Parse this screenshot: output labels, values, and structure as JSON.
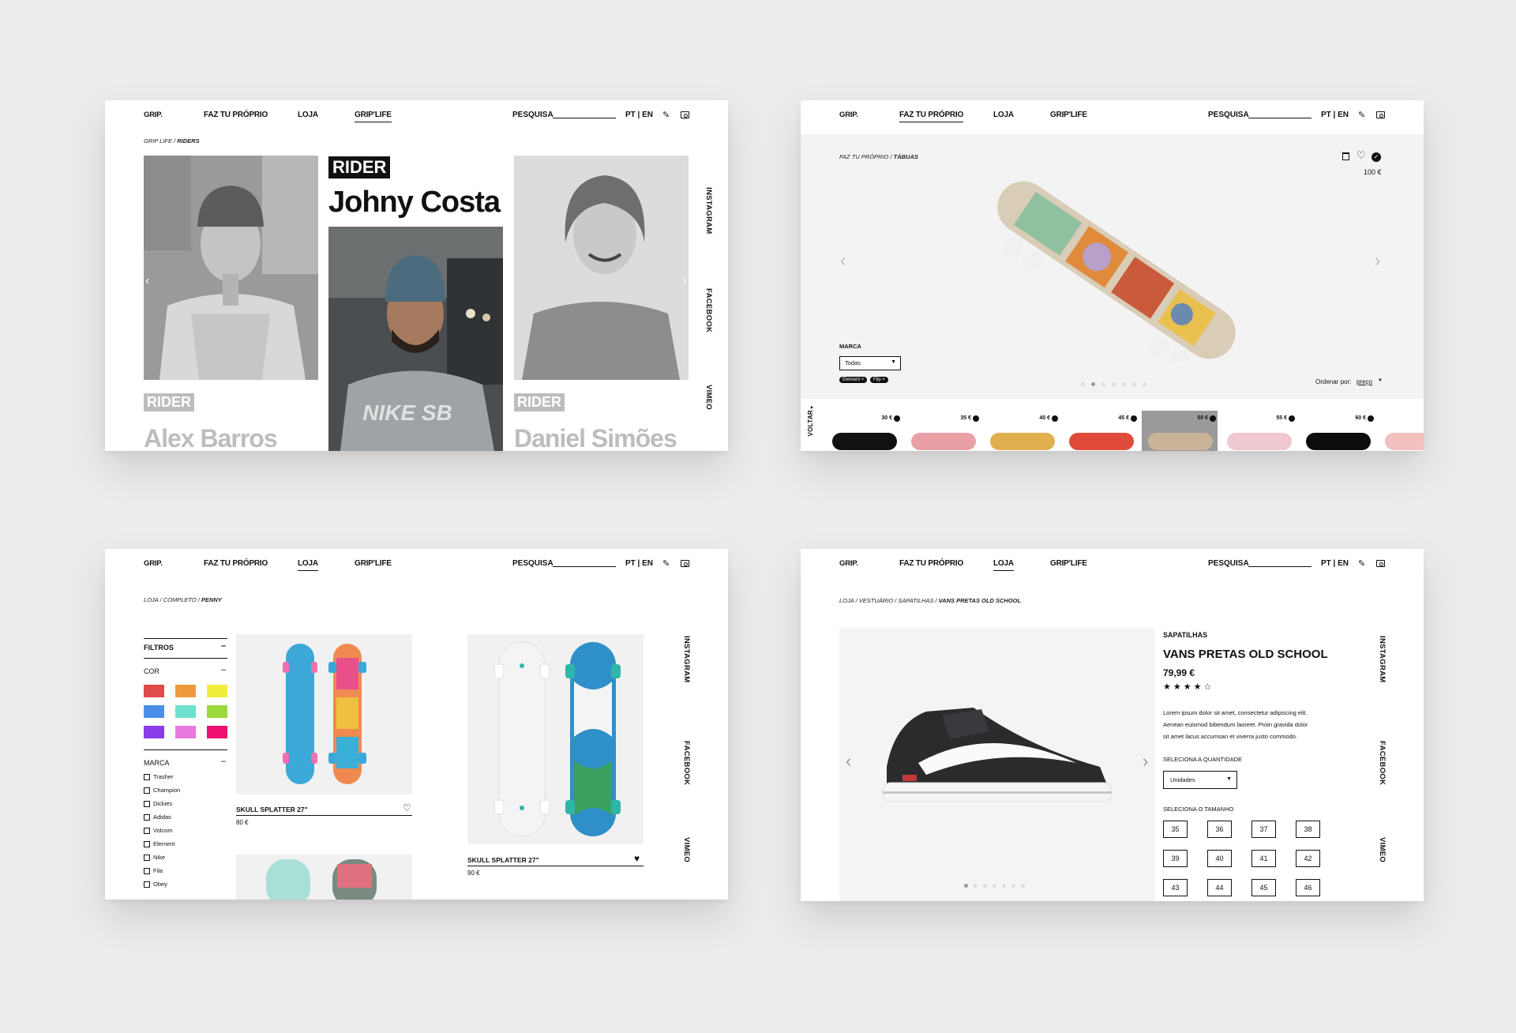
{
  "nav": {
    "logo": "GRIP.",
    "faz": "FAZ TU PRÓPRIO",
    "loja": "LOJA",
    "griplife": "GRIP'LIFE",
    "search": "PESQUISA",
    "lang": "PT | EN"
  },
  "social": {
    "instagram": "INSTAGRAM",
    "facebook": "FACEBOOK",
    "vimeo": "VIMEO"
  },
  "icons": [
    "pencil-icon",
    "cart-icon",
    "trash-icon",
    "heart-icon",
    "check-icon",
    "chevron-left-icon",
    "chevron-right-icon"
  ],
  "panel1": {
    "breadcrumb": {
      "parent": "GRIP LIFE / ",
      "current": "RIDERS"
    },
    "tag": "RIDER",
    "featured": "Johny Costa",
    "left_name": "Alex Barros",
    "right_name": "Daniel Simões"
  },
  "panel2": {
    "breadcrumb": {
      "parent": "FAZ TU PRÓPRIO / ",
      "current": "TÁBUAS"
    },
    "price": "100 €",
    "marca_label": "MARCA",
    "marca_select": "Todas",
    "chips": [
      "Element ×",
      "Flip ×"
    ],
    "sort_label": "Ordenar por:",
    "sort_value": "preço",
    "back": "VOLTAR",
    "thumbs": [
      {
        "price": "30 €",
        "deck": "#111111"
      },
      {
        "price": "35 €",
        "deck": "#e8a0a6"
      },
      {
        "price": "40 €",
        "deck": "#e0b050"
      },
      {
        "price": "45 €",
        "deck": "#e04a3a"
      },
      {
        "price": "50 €",
        "deck": "#c9b49a"
      },
      {
        "price": "55 €",
        "deck": "#f0c8d0"
      },
      {
        "price": "60 €",
        "deck": "#0d0d0d"
      },
      {
        "price": "",
        "deck": "#f3c0c0"
      }
    ]
  },
  "panel3": {
    "breadcrumb": {
      "parent": "LOJA / COMPLETO / ",
      "current": "PENNY"
    },
    "filters": "FILTROS",
    "cor": "COR",
    "marca": "MARCA",
    "colors": [
      "#e04a4a",
      "#ee9a3c",
      "#f0ee3a",
      "#4a8ee8",
      "#6fe0d0",
      "#9bd83a",
      "#8a3ce8",
      "#e87ae0",
      "#ee1070"
    ],
    "brands": [
      "Trasher",
      "Champion",
      "Dickies",
      "Adidas",
      "Volcom",
      "Element",
      "Nike",
      "Fila",
      "Obey"
    ],
    "products": [
      {
        "name": "SKULL SPLATTER 27\"",
        "price": "80 €"
      },
      {
        "name": "SKULL SPLATTER 27\"",
        "price": "90 €"
      }
    ]
  },
  "panel4": {
    "breadcrumb": {
      "parent": "LOJA / VESTUÁRIO / SAPATILHAS / ",
      "current": "VANS PRETAS OLD SCHOOL"
    },
    "category": "SAPATILHAS",
    "title": "VANS PRETAS OLD SCHOOL",
    "price": "79,99 €",
    "rating": 4,
    "rating_max": 5,
    "desc1": "Lorem ipsum dolor sit amet, consectetur adipiscing elit.",
    "desc2": "Aenean euismod bibendum laoreet. Proin gravida dolor",
    "desc3": "sit amet lacus accumsan et viverra justo commodo.",
    "qty_label": "SELECIONA A QUANTIDADE",
    "qty_value": "Unidades",
    "size_label": "SELECIONA O TAMANHO",
    "sizes": [
      "35",
      "36",
      "37",
      "38",
      "39",
      "40",
      "41",
      "42",
      "43",
      "44",
      "45",
      "46"
    ]
  }
}
